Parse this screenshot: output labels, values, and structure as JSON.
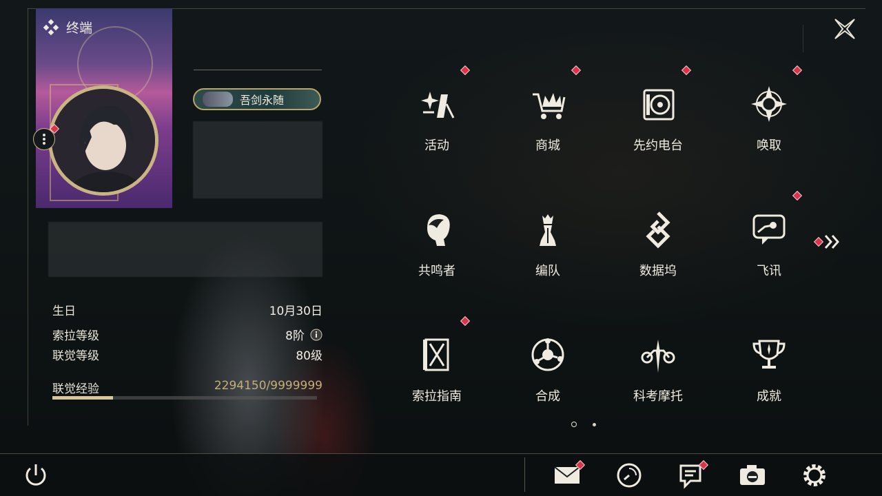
{
  "window": {
    "title": "终端"
  },
  "profile": {
    "title_badge": "吾剑永随",
    "stats": [
      {
        "label": "生日",
        "value": "10月30日"
      },
      {
        "label": "索拉等级",
        "value": "8阶"
      },
      {
        "label": "联觉等级",
        "value": "80级"
      }
    ],
    "experience": {
      "label": "联觉经验",
      "value": "2294150/9999999",
      "progress": 0.229
    }
  },
  "grid": {
    "items": [
      {
        "label": "活动",
        "icon": "sparkle-icon",
        "badge": true
      },
      {
        "label": "商城",
        "icon": "crown-cart-icon",
        "badge": true
      },
      {
        "label": "先约电台",
        "icon": "radio-vinyl-icon",
        "badge": true
      },
      {
        "label": "唤取",
        "icon": "compass-star-icon",
        "badge": true
      },
      {
        "label": "共鸣者",
        "icon": "character-head-icon",
        "badge": false
      },
      {
        "label": "编队",
        "icon": "chess-team-icon",
        "badge": false
      },
      {
        "label": "数据坞",
        "icon": "data-dock-icon",
        "badge": false
      },
      {
        "label": "飞讯",
        "icon": "chat-message-icon",
        "badge": true
      },
      {
        "label": "索拉指南",
        "icon": "guide-book-icon",
        "badge": true
      },
      {
        "label": "合成",
        "icon": "synthesis-icon",
        "badge": false
      },
      {
        "label": "科考摩托",
        "icon": "motorcycle-icon",
        "badge": false
      },
      {
        "label": "成就",
        "icon": "trophy-icon",
        "badge": false
      }
    ],
    "pager": {
      "pages": 2,
      "current": 1
    }
  },
  "bottombar": {
    "buttons": [
      {
        "name": "mail",
        "icon": "mail-icon",
        "badge": true
      },
      {
        "name": "clock",
        "icon": "clock-icon",
        "badge": false
      },
      {
        "name": "notes",
        "icon": "notes-icon",
        "badge": true
      },
      {
        "name": "camera",
        "icon": "camera-icon",
        "badge": false
      },
      {
        "name": "settings",
        "icon": "gear-icon",
        "badge": false
      }
    ]
  },
  "colors": {
    "accent_gold": "#c9b583",
    "badge_red": "#d9354a",
    "text_light": "#f0ebe0"
  }
}
